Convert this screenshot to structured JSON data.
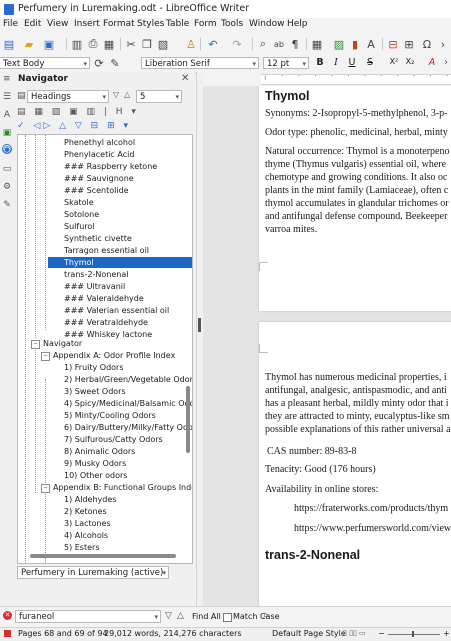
{
  "window": {
    "title": "Perfumery in Luremaking.odt - LibreOffice Writer"
  },
  "menu": [
    "File",
    "Edit",
    "View",
    "Insert",
    "Format",
    "Styles",
    "Table",
    "Form",
    "Tools",
    "Window",
    "Help"
  ],
  "toolbar2": {
    "paragraph_style": "Text Body",
    "font_name": "Liberation Serif",
    "font_size": "12 pt",
    "bold": "B",
    "italic": "I",
    "underline": "U",
    "strike": "S",
    "superscript": "X²",
    "subscript": "X₂"
  },
  "navigator": {
    "title": "Navigator",
    "content_type": "Headings",
    "outline_level": "5",
    "items": [
      {
        "label": "Phenethyl alcohol"
      },
      {
        "label": "Phenylacetic Acid"
      },
      {
        "label": "### Raspberry ketone"
      },
      {
        "label": "### Sauvignone"
      },
      {
        "label": "### Scentolide"
      },
      {
        "label": "Skatole"
      },
      {
        "label": "Sotolone"
      },
      {
        "label": "Sulfurol"
      },
      {
        "label": "Synthetic civette"
      },
      {
        "label": "Tarragon essential oil"
      },
      {
        "label": "Thymol",
        "selected": true
      },
      {
        "label": "trans-2-Nonenal"
      },
      {
        "label": "### Ultravanil"
      },
      {
        "label": "### Valeraldehyde"
      },
      {
        "label": "### Valerian essential oil"
      },
      {
        "label": "### Veratraldehyde"
      },
      {
        "label": "### Whiskey lactone"
      }
    ],
    "section": "Navigator",
    "appendix_a": "Appendix A: Odor Profile Index",
    "appendix_a_items": [
      "1) Fruity Odors",
      "2) Herbal/Green/Vegetable Odors",
      "3) Sweet Odors",
      "4) Spicy/Medicinal/Balsamic Odors",
      "5) Minty/Cooling Odors",
      "6) Dairy/Buttery/Milky/Fatty Odors",
      "7) Sulfurous/Catty Odors",
      "8) Animalic Odors",
      "9) Musky Odors",
      "10) Other odors"
    ],
    "appendix_b": "Appendix B: Functional Groups Index",
    "appendix_b_items": [
      "1) Aldehydes",
      "2) Ketones",
      "3) Lactones",
      "4) Alcohols",
      "5) Esters"
    ],
    "document_select": "Perfumery in Luremaking (active)"
  },
  "document": {
    "page1": {
      "heading": "Thymol",
      "synonyms": "Synonyms: 2-Isopropyl-5-methylphenol, 3-p-",
      "odor_type": "Odor type: phenolic, medicinal, herbal, minty",
      "para": [
        "Natural occurrence: Thymol is a monoterpeno",
        "thyme (Thymus vulgaris) essential oil, where",
        "chemotype and growing conditions. It also oc",
        "plants in the mint family (Lamiaceae), often c",
        "thymol accumulates in glandular trichomes or",
        "and antifungal defense compound. Beekeeper",
        "varroa mites."
      ]
    },
    "page2": {
      "para": [
        "Thymol has numerous medicinal properties, i",
        "antifungal, analgesic, antispasmodic, and anti",
        "has a pleasant herbal, mildly minty odor that i",
        "they are attracted to minty, eucalyptus-like sm",
        "possible explanations of this rather universal a"
      ],
      "cas": "CAS number: 89-83-8",
      "tenacity": "Tenacity: Good (176 hours)",
      "availability": "Availability in online stores:",
      "links": [
        "https://fraterworks.com/products/thym",
        "https://www.perfumersworld.com/view"
      ],
      "heading2": "trans-2-Nonenal"
    }
  },
  "findbar": {
    "search_value": "furaneol",
    "find_all": "Find All",
    "match_case": "Match Case"
  },
  "statusbar": {
    "pages": "Pages 68 and 69 of 94",
    "words": "29,012 words, 214,276 characters",
    "page_style": "Default Page Style"
  },
  "colors": {
    "accent": "#1d66c7",
    "page": "#ffffff"
  }
}
